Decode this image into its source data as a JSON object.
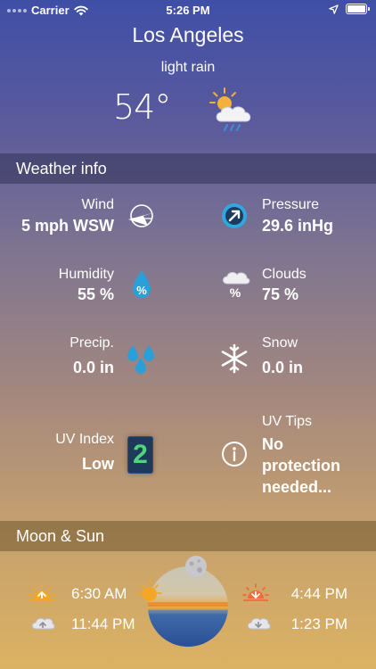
{
  "status_bar": {
    "carrier": "Carrier",
    "time": "5:26 PM"
  },
  "weather": {
    "city": "Los Angeles",
    "condition": "light rain",
    "temperature": "54°",
    "icon": "sun-cloud-rain-icon"
  },
  "weather_info": {
    "title": "Weather info",
    "wind": {
      "label": "Wind",
      "value": "5 mph WSW",
      "icon": "wind-direction-icon"
    },
    "pressure": {
      "label": "Pressure",
      "value": "29.6 inHg",
      "icon": "pressure-gauge-icon"
    },
    "humidity": {
      "label": "Humidity",
      "value": "55 %",
      "icon": "humidity-drop-icon"
    },
    "clouds": {
      "label": "Clouds",
      "value": "75 %",
      "icon": "cloud-percent-icon"
    },
    "precip": {
      "label": "Precip.",
      "value": "0.0 in",
      "icon": "rain-drops-icon"
    },
    "snow": {
      "label": "Snow",
      "value": "0.0 in",
      "icon": "snowflake-icon"
    },
    "uv_index": {
      "label": "UV Index",
      "value": "Low",
      "level": "2"
    },
    "uv_tips": {
      "label": "UV Tips",
      "value_lines": [
        "No",
        "protection",
        "needed..."
      ],
      "icon": "info-icon"
    }
  },
  "moon_sun": {
    "title": "Moon & Sun",
    "sunrise": "6:30 AM",
    "sunset": "4:44 PM",
    "moonrise": "11:44 PM",
    "moonset": "1:23 PM"
  },
  "colors": {
    "uv_level": "#4fd67a",
    "pressure_accent": "#2fa8e0",
    "humidity_accent": "#2a9fd8",
    "sunrise_accent": "#f5a623",
    "sunset_accent": "#f06a3a"
  }
}
